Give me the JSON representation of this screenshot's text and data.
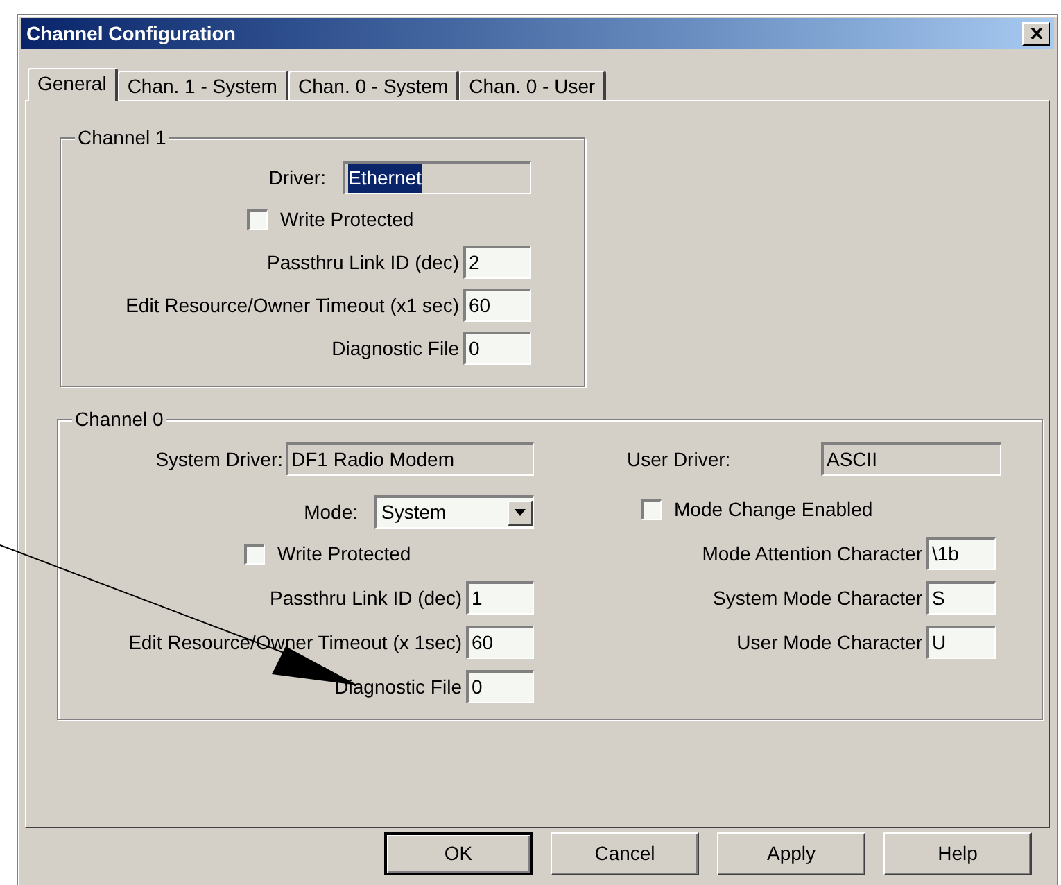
{
  "window": {
    "title": "Channel Configuration"
  },
  "tabs": [
    {
      "label": "General",
      "selected": true
    },
    {
      "label": "Chan. 1 - System",
      "selected": false
    },
    {
      "label": "Chan. 0 - System",
      "selected": false
    },
    {
      "label": "Chan. 0 - User",
      "selected": false
    }
  ],
  "channel_1": {
    "title": "Channel 1",
    "driver": {
      "label": "Driver:",
      "value": "Ethernet",
      "highlighted": true
    },
    "write_protected": {
      "label": "Write Protected",
      "checked": false
    },
    "fields": [
      {
        "label": "Passthru Link ID (dec)",
        "value": "2"
      },
      {
        "label": "Edit Resource/Owner Timeout (x1 sec)",
        "value": "60"
      },
      {
        "label": "Diagnostic File",
        "value": "0"
      }
    ]
  },
  "channel_0": {
    "title": "Channel 0",
    "system_driver": {
      "label": "System Driver:",
      "value": "DF1 Radio Modem"
    },
    "mode": {
      "label": "Mode:",
      "value": "System"
    },
    "write_protected": {
      "label": "Write Protected",
      "checked": false
    },
    "fields": [
      {
        "label": "Passthru Link ID (dec)",
        "value": "1"
      },
      {
        "label": "Edit Resource/Owner Timeout (x 1sec)",
        "value": "60"
      },
      {
        "label": "Diagnostic File",
        "value": "0"
      }
    ],
    "user_driver": {
      "label": "User Driver:",
      "value": "ASCII"
    },
    "mode_change_enabled": {
      "label": "Mode Change Enabled",
      "checked": false
    },
    "user_fields": [
      {
        "label": "Mode Attention Character",
        "value": "\\1b"
      },
      {
        "label": "System Mode Character",
        "value": "S"
      },
      {
        "label": "User Mode Character",
        "value": "U"
      }
    ]
  },
  "buttons": [
    {
      "label": "OK",
      "default": true
    },
    {
      "label": "Cancel",
      "default": false
    },
    {
      "label": "Apply",
      "default": false
    },
    {
      "label": "Help",
      "default": false
    }
  ]
}
